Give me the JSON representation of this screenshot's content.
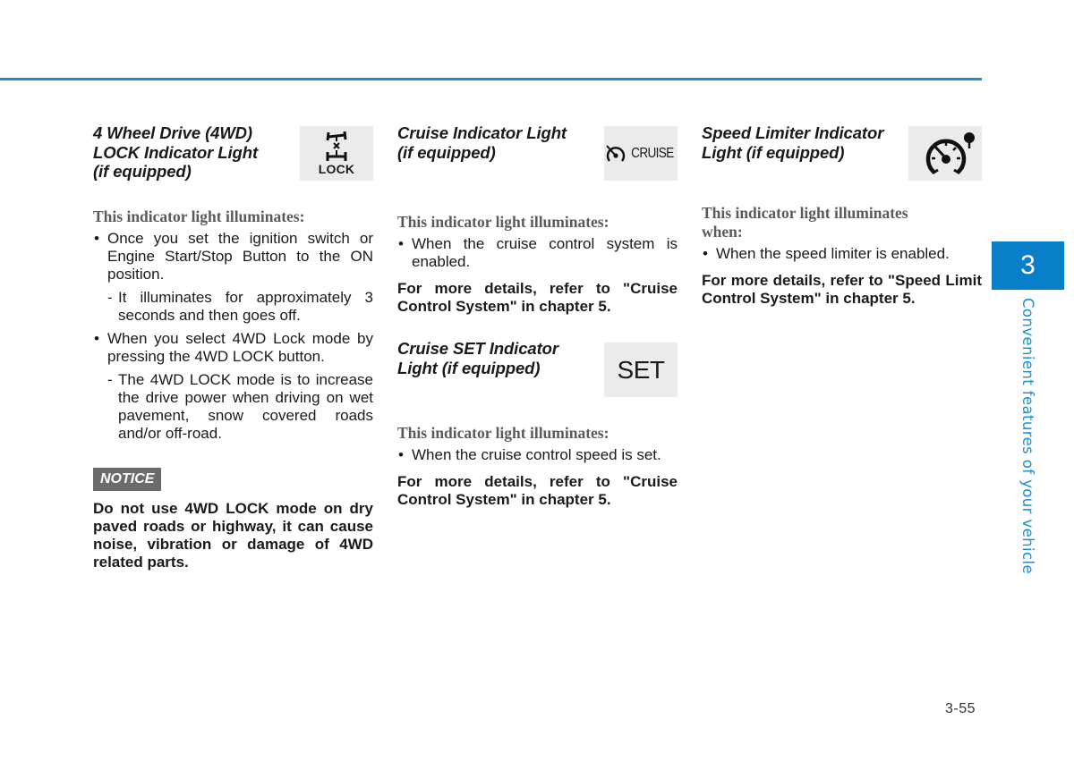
{
  "page": {
    "page_number": "3-55",
    "chapter": {
      "number": "3",
      "title": "Convenient features of your vehicle"
    },
    "accent_color": "#0a7fc9"
  },
  "sections": {
    "wd4": {
      "title_lines": [
        "4 Wheel Drive (4WD)",
        "LOCK Indicator Light",
        "(if equipped)"
      ],
      "icon": {
        "name": "4wd-lock-icon",
        "label": "LOCK"
      },
      "subheading": "This indicator light illuminates:",
      "bullets": [
        {
          "text": "Once you set the ignition switch or Engine Start/Stop Button to the ON position.",
          "sub": "It illuminates for approximately 3 seconds and then goes off."
        },
        {
          "text": "When you select 4WD Lock mode by pressing the 4WD LOCK button.",
          "sub": "The 4WD LOCK mode is to increase the drive power when driving on wet pavement, snow covered roads and/or off-road."
        }
      ],
      "notice_label": "NOTICE",
      "notice_text": "Do not use 4WD LOCK mode on dry paved roads or highway, it can cause noise, vibration or damage of 4WD related parts."
    },
    "cruise": {
      "title_lines": [
        "Cruise Indicator Light",
        "(if equipped)"
      ],
      "icon": {
        "name": "cruise-icon",
        "label": "CRUISE"
      },
      "subheading": "This indicator light illuminates:",
      "bullets": [
        "When the cruise control system is enabled."
      ],
      "more": "For more details, refer to \"Cruise Control System\" in chapter 5."
    },
    "cruise_set": {
      "title_lines": [
        "Cruise SET Indicator",
        "Light (if equipped)"
      ],
      "icon": {
        "name": "cruise-set-icon",
        "label": "SET"
      },
      "subheading": "This indicator light illuminates:",
      "bullets": [
        "When the cruise control speed is set."
      ],
      "more": "For more details, refer to \"Cruise Control System\" in chapter 5."
    },
    "speed_limiter": {
      "title_lines": [
        "Speed Limiter Indicator",
        "Light (if equipped)"
      ],
      "icon": {
        "name": "speed-limiter-icon"
      },
      "subheading": "This indicator light illuminates when:",
      "bullets": [
        "When the speed limiter is enabled."
      ],
      "more": "For more details, refer to \"Speed Limit Control System\" in chapter 5."
    }
  }
}
